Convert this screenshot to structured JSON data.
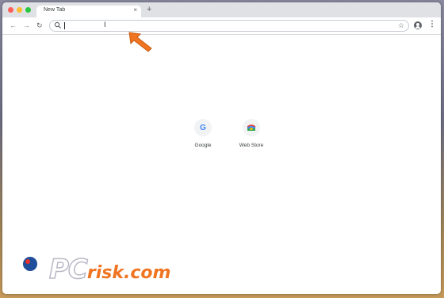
{
  "browser": {
    "tab": {
      "title": "New Tab",
      "close": "×"
    },
    "new_tab": "+",
    "toolbar": {
      "back": "←",
      "forward": "→",
      "reload": "↻",
      "star": "☆",
      "menu": "⋮"
    },
    "omnibox": {
      "value": ""
    }
  },
  "shortcuts": [
    {
      "label": "Google",
      "icon": "google-icon"
    },
    {
      "label": "Web Store",
      "icon": "webstore-icon"
    }
  ],
  "watermark": {
    "brand": "PC",
    "suffix": "risk.com"
  },
  "colors": {
    "accent": "#f07522",
    "tab_bar": "#dfe1e5",
    "google_blue": "#4285f4"
  }
}
